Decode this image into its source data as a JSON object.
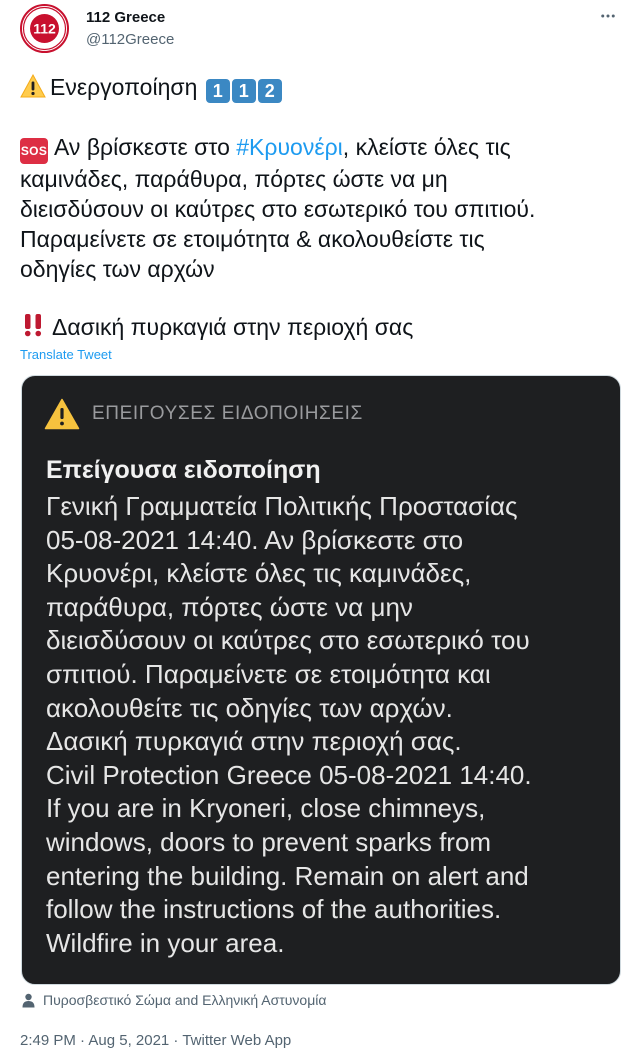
{
  "account": {
    "display_name": "112 Greece",
    "handle": "@112Greece",
    "avatar_label": "112"
  },
  "tweet": {
    "line1_text": "Ενεργοποίηση",
    "keycaps": [
      "1",
      "1",
      "2"
    ],
    "sos_label": "SOS",
    "para_start": "Αν βρίσκεστε στο ",
    "hashtag": "#Κρυονέρι",
    "para_line1_end": ", κλείστε όλες τις",
    "para_line2": "καμινάδες, παράθυρα, πόρτες ώστε να μη",
    "para_line3": "διεισδύσουν οι καύτρες στο εσωτερικό του σπιτιού.",
    "para_line4": "Παραμείνετε σε ετοιμότητα & ακολουθείστε τις",
    "para_line5": "οδηγίες των αρχών",
    "fire_line": "Δασική πυρκαγιά στην περιοχή σας",
    "translate_label": "Translate Tweet"
  },
  "alert_image": {
    "header_label": "ΕΠΕΙΓΟΥΣΕΣ ΕΙΔΟΠΟΙΗΣΕΙΣ",
    "title": "Επείγουσα ειδοποίηση",
    "body": "Γενική Γραμματεία Πολιτικής Προστασίας\n05-08-2021 14:40. Αν βρίσκεστε στο\nΚρυονέρι, κλείστε όλες τις καμινάδες,\nπαράθυρα, πόρτες ώστε να μην\nδιεισδύσουν οι καύτρες στο εσωτερικό του\nσπιτιού. Παραμείνετε σε ετοιμότητα και\nακολουθείτε τις οδηγίες των αρχών.\nΔασική πυρκαγιά στην περιοχή σας.\nCivil Protection Greece 05-08-2021 14:40.\nIf you are in Kryoneri, close chimneys,\nwindows, doors to prevent sparks from\nentering the building. Remain on alert and\nfollow the instructions of the authorities.\nWildfire in your area."
  },
  "tagged_people": "Πυροσβεστικό Σώμα and Ελληνική Αστυνομία",
  "meta": {
    "timestamp": "2:49 PM · Aug 5, 2021 · Twitter Web App"
  },
  "icons": {
    "more": "more-horizontal-icon",
    "warning": "warning-icon",
    "sos": "sos-icon",
    "bangbang": "double-exclamation-icon",
    "person": "person-icon"
  },
  "colors": {
    "link": "#1d9bf0",
    "text": "#0f1419",
    "muted": "#536471",
    "alert_bg": "#1e1f21",
    "brand_red": "#c8102e"
  }
}
